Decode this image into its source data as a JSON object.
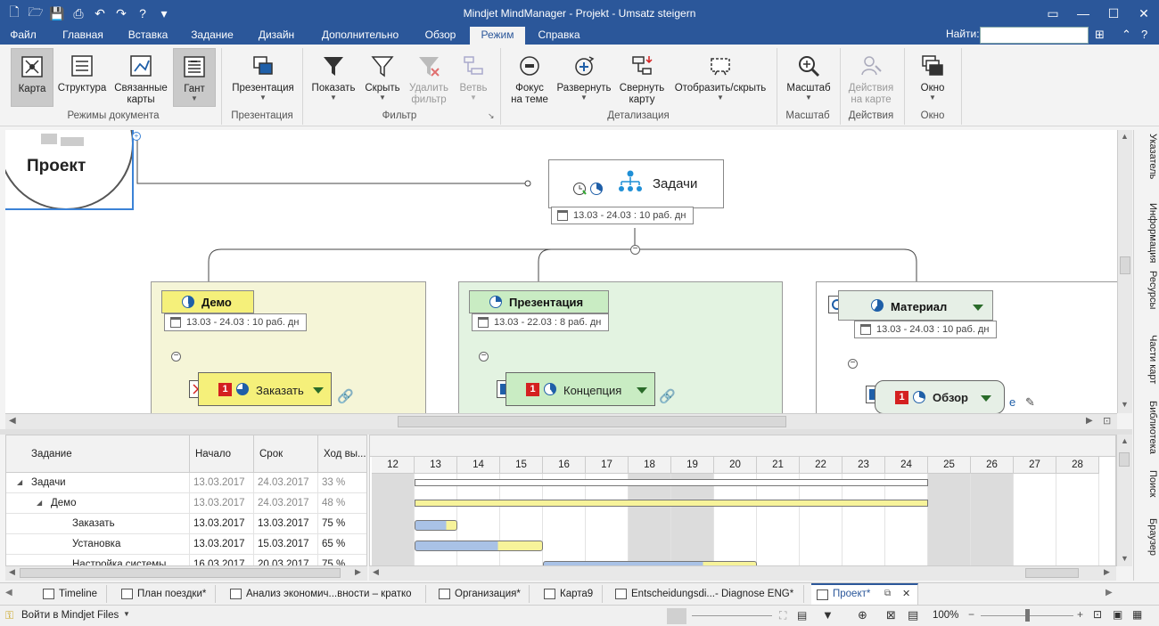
{
  "window": {
    "title": "Mindjet MindManager - Projekt - Umsatz steigern"
  },
  "menu": {
    "tabs": [
      "Файл",
      "Главная",
      "Вставка",
      "Задание",
      "Дизайн",
      "Дополнительно",
      "Обзор",
      "Режим",
      "Справка"
    ],
    "active_tab": "Режим",
    "find_label": "Найти:",
    "find_value": ""
  },
  "ribbon": {
    "doc_modes": {
      "group_label": "Режимы документа",
      "map": "Карта",
      "structure": "Структура",
      "linked_l1": "Связанные",
      "linked_l2": "карты",
      "gantt": "Гант"
    },
    "presentation": {
      "group_label": "Презентация",
      "button": "Презентация"
    },
    "filter": {
      "group_label": "Фильтр",
      "show": "Показать",
      "hide": "Скрыть",
      "remove_l1": "Удалить",
      "remove_l2": "фильтр",
      "branch": "Ветвь"
    },
    "detail": {
      "group_label": "Детализация",
      "focus_l1": "Фокус",
      "focus_l2": "на теме",
      "expand": "Развернуть",
      "collapse_l1": "Свернуть",
      "collapse_l2": "карту",
      "show_hide": "Отобразить/скрыть"
    },
    "zoom": {
      "group_label": "Масштаб",
      "button": "Масштаб"
    },
    "actions": {
      "group_label": "Действия",
      "l1": "Действия",
      "l2": "на карте"
    },
    "window": {
      "group_label": "Окно",
      "button": "Окно"
    }
  },
  "map": {
    "central": "Проект",
    "tasks": {
      "label": "Задачи",
      "date": "13.03 - 24.03 : 10 раб. дн"
    },
    "demo": {
      "label": "Демо",
      "date": "13.03 - 24.03 : 10 раб. дн",
      "child": "Заказать",
      "child_prio": "1"
    },
    "presentation": {
      "label": "Презентация",
      "date": "13.03 - 22.03 : 8 раб. дн",
      "child": "Концепция",
      "child_prio": "1"
    },
    "material": {
      "label": "Материал",
      "date": "13.03 - 24.03 : 10 раб. дн",
      "child": "Обзор",
      "child_prio": "1"
    }
  },
  "side_panel": [
    "Указатель",
    "Информация",
    "Ресурсы",
    "Части карт",
    "Библиотека",
    "Поиск",
    "Браузер"
  ],
  "grid": {
    "headers": [
      "Задание",
      "Начало",
      "Срок",
      "Ход вы..."
    ],
    "rows": [
      {
        "name": "Задачи",
        "start": "13.03.2017",
        "end": "24.03.2017",
        "progress": "33 %"
      },
      {
        "name": "Демо",
        "start": "13.03.2017",
        "end": "24.03.2017",
        "progress": "48 %"
      },
      {
        "name": "Заказать",
        "start": "13.03.2017",
        "end": "13.03.2017",
        "progress": "75 %"
      },
      {
        "name": "Установка",
        "start": "13.03.2017",
        "end": "15.03.2017",
        "progress": "65 %"
      },
      {
        "name": "Настройка системы",
        "start": "16.03.2017",
        "end": "20.03.2017",
        "progress": "75 %"
      }
    ]
  },
  "gantt": {
    "days": [
      "12",
      "13",
      "14",
      "15",
      "16",
      "17",
      "18",
      "19",
      "20",
      "21",
      "22",
      "23",
      "24",
      "25",
      "26",
      "27",
      "28"
    ],
    "weekend": [
      "12",
      "18",
      "19",
      "25",
      "26"
    ]
  },
  "doc_tabs": [
    "Timeline",
    "План поездки*",
    "Анализ экономич...вности – кратко",
    "Организация*",
    "Карта9",
    "Entscheidungsdi...- Diagnose ENG*",
    "Проект*"
  ],
  "active_doc": "Проект*",
  "status": {
    "login": "Войти в Mindjet Files",
    "zoom": "100%"
  },
  "colors": {
    "accent": "#2b579a",
    "demo_bg": "#f5f5d7",
    "demo_topic": "#f5f07a",
    "pres_bg": "#e3f3e1",
    "pres_topic": "#c9ecc3",
    "material_bg": "#ffffff",
    "material_topic": "#e6efe6",
    "bar_done": "#a9c2e6",
    "bar_todo": "#f7f39a"
  }
}
